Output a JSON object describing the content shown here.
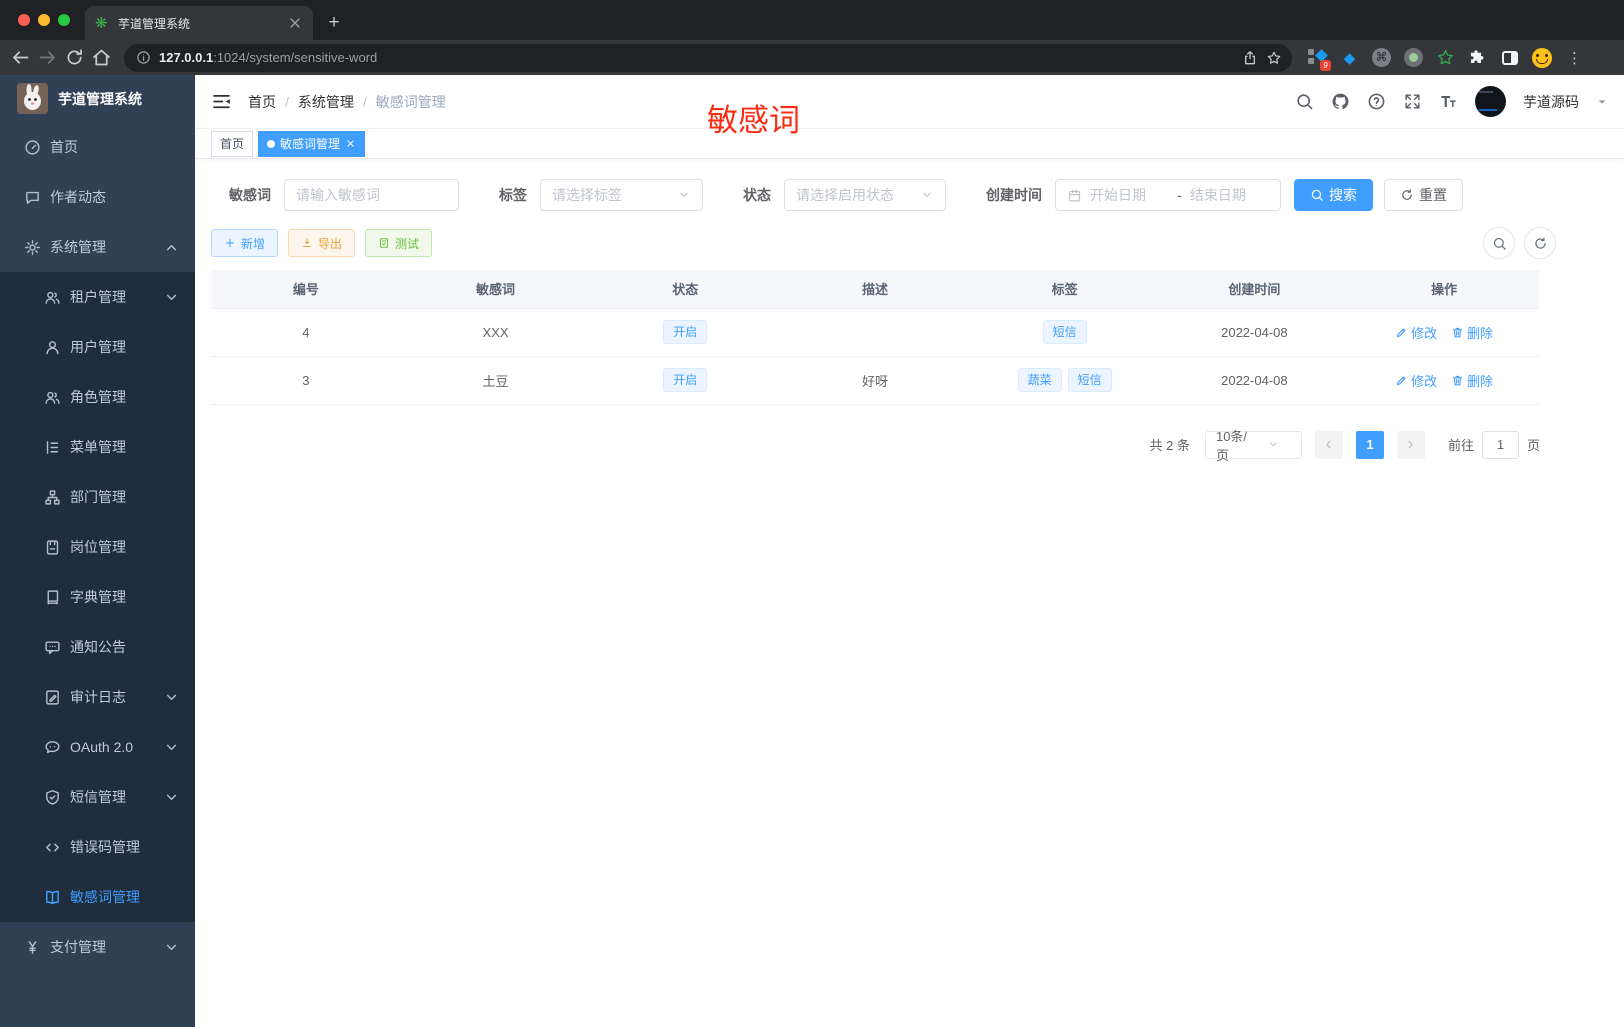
{
  "browser": {
    "tab_title": "芋道管理系统",
    "url_host": "127.0.0.1",
    "url_rest": ":1024/system/sensitive-word",
    "extension_badge": "9"
  },
  "sidebar": {
    "logo_title": "芋道管理系统",
    "items": [
      {
        "label": "首页",
        "icon": "dashboard-icon",
        "sub": false
      },
      {
        "label": "作者动态",
        "icon": "chat-icon",
        "sub": false
      },
      {
        "label": "系统管理",
        "icon": "gear-icon",
        "sub": false,
        "arrow": "up"
      },
      {
        "label": "租户管理",
        "icon": "users-icon",
        "sub": true,
        "arrow": "down"
      },
      {
        "label": "用户管理",
        "icon": "user-icon",
        "sub": true
      },
      {
        "label": "角色管理",
        "icon": "users-icon",
        "sub": true
      },
      {
        "label": "菜单管理",
        "icon": "menu-tree-icon",
        "sub": true
      },
      {
        "label": "部门管理",
        "icon": "org-icon",
        "sub": true
      },
      {
        "label": "岗位管理",
        "icon": "badge-icon",
        "sub": true
      },
      {
        "label": "字典管理",
        "icon": "dict-icon",
        "sub": true
      },
      {
        "label": "通知公告",
        "icon": "notice-icon",
        "sub": true
      },
      {
        "label": "审计日志",
        "icon": "audit-icon",
        "sub": true,
        "arrow": "down"
      },
      {
        "label": "OAuth 2.0",
        "icon": "oauth-icon",
        "sub": true,
        "arrow": "down"
      },
      {
        "label": "短信管理",
        "icon": "sms-shield-icon",
        "sub": true,
        "arrow": "down"
      },
      {
        "label": "错误码管理",
        "icon": "code-icon",
        "sub": true
      },
      {
        "label": "敏感词管理",
        "icon": "book-open-icon",
        "sub": true,
        "active": true
      },
      {
        "label": "支付管理",
        "icon": "yen-icon",
        "sub": false,
        "arrow": "down"
      }
    ]
  },
  "header": {
    "breadcrumb": [
      "首页",
      "系统管理",
      "敏感词管理"
    ],
    "watermark": "敏感词",
    "username": "芋道源码"
  },
  "page_tabs": [
    {
      "label": "首页",
      "active": false,
      "closable": false
    },
    {
      "label": "敏感词管理",
      "active": true,
      "closable": true
    }
  ],
  "filters": {
    "keyword_label": "敏感词",
    "keyword_placeholder": "请输入敏感词",
    "tag_label": "标签",
    "tag_placeholder": "请选择标签",
    "status_label": "状态",
    "status_placeholder": "请选择启用状态",
    "date_label": "创建时间",
    "date_start_placeholder": "开始日期",
    "date_separator": "-",
    "date_end_placeholder": "结束日期",
    "search_label": "搜索",
    "reset_label": "重置"
  },
  "toolbar": {
    "add_label": "新增",
    "export_label": "导出",
    "test_label": "测试"
  },
  "table": {
    "columns": [
      "编号",
      "敏感词",
      "状态",
      "描述",
      "标签",
      "创建时间",
      "操作"
    ],
    "actions": {
      "edit": "修改",
      "delete": "删除"
    },
    "rows": [
      {
        "id": "4",
        "word": "XXX",
        "status": "开启",
        "description": "",
        "tags": [
          "短信"
        ],
        "created": "2022-04-08"
      },
      {
        "id": "3",
        "word": "土豆",
        "status": "开启",
        "description": "好呀",
        "tags": [
          "蔬菜",
          "短信"
        ],
        "created": "2022-04-08"
      }
    ]
  },
  "pagination": {
    "total_label": "共 2 条",
    "page_size": "10条/页",
    "current_page": "1",
    "goto_label": "前往",
    "goto_value": "1",
    "page_label": "页"
  },
  "colors": {
    "accent": "#409eff",
    "watermark_red": "#fa2c12",
    "warning": "#e6a23c",
    "success": "#67c23a",
    "sidebar_bg": "#304156",
    "submenu_bg": "#1f2d3d",
    "tag_bg": "#ecf5ff"
  }
}
